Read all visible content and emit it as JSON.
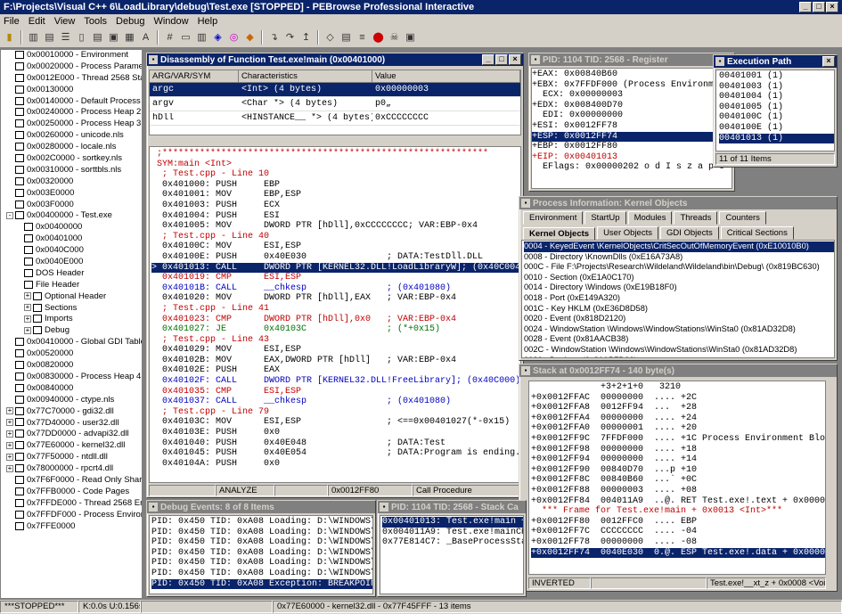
{
  "app": {
    "title": "F:\\Projects\\Visual C++ 6\\LoadLibrary\\debug\\Test.exe [STOPPED] - PEBrowse Professional Interactive",
    "menu": [
      "File",
      "Edit",
      "View",
      "Tools",
      "Debug",
      "Window",
      "Help"
    ]
  },
  "tree": [
    {
      "t": "0x00010000 - Environment",
      "d": 1
    },
    {
      "t": "0x00020000 - Process Paramet",
      "d": 1
    },
    {
      "t": "0x0012E000 - Thread 2568 Sta",
      "d": 1
    },
    {
      "t": "0x00130000",
      "d": 1
    },
    {
      "t": "0x00140000 - Default Process I",
      "d": 1
    },
    {
      "t": "0x00240000 - Process Heap 2",
      "d": 1
    },
    {
      "t": "0x00250000 - Process Heap 3",
      "d": 1
    },
    {
      "t": "0x00260000 - unicode.nls",
      "d": 1
    },
    {
      "t": "0x00280000 - locale.nls",
      "d": 1
    },
    {
      "t": "0x002C0000 - sortkey.nls",
      "d": 1
    },
    {
      "t": "0x00310000 - sorttbls.nls",
      "d": 1
    },
    {
      "t": "0x00320000",
      "d": 1
    },
    {
      "t": "0x003E0000",
      "d": 1
    },
    {
      "t": "0x003F0000",
      "d": 1
    },
    {
      "t": "0x00400000 - Test.exe",
      "d": 0,
      "ex": "-"
    },
    {
      "t": "0x00400000",
      "d": 2
    },
    {
      "t": "0x00401000",
      "d": 2
    },
    {
      "t": "0x0040C000",
      "d": 2
    },
    {
      "t": "0x0040E000",
      "d": 2
    },
    {
      "t": "DOS Header",
      "d": 2
    },
    {
      "t": "File Header",
      "d": 2
    },
    {
      "t": "Optional Header",
      "d": 2,
      "ex": "+"
    },
    {
      "t": "Sections",
      "d": 2,
      "ex": "+"
    },
    {
      "t": "Imports",
      "d": 2,
      "ex": "+"
    },
    {
      "t": "Debug",
      "d": 2,
      "ex": "+"
    },
    {
      "t": "0x00410000 - Global GDI Table",
      "d": 1
    },
    {
      "t": "0x00520000",
      "d": 1
    },
    {
      "t": "0x00820000",
      "d": 1
    },
    {
      "t": "0x00830000 - Process Heap 4",
      "d": 1
    },
    {
      "t": "0x00840000",
      "d": 1
    },
    {
      "t": "0x00940000 - ctype.nls",
      "d": 1
    },
    {
      "t": "0x77C70000 - gdi32.dll",
      "d": 0,
      "ex": "+"
    },
    {
      "t": "0x77D40000 - user32.dll",
      "d": 0,
      "ex": "+"
    },
    {
      "t": "0x77DD0000 - advapi32.dll",
      "d": 0,
      "ex": "+"
    },
    {
      "t": "0x77E60000 - kernel32.dll",
      "d": 0,
      "ex": "+"
    },
    {
      "t": "0x77F50000 - ntdll.dll",
      "d": 0,
      "ex": "+"
    },
    {
      "t": "0x78000000 - rpcrt4.dll",
      "d": 0,
      "ex": "+"
    },
    {
      "t": "0x7F6F0000 - Read Only Share",
      "d": 1
    },
    {
      "t": "0x7FFB0000 - Code Pages",
      "d": 1
    },
    {
      "t": "0x7FFDE000 - Thread 2568 En",
      "d": 1
    },
    {
      "t": "0x7FFDF000 - Process Environ",
      "d": 1
    },
    {
      "t": "0x7FFE0000",
      "d": 1
    }
  ],
  "disasm": {
    "title": "Disassembly of Function Test.exe!main (0x00401000)",
    "columns": [
      "ARG/VAR/SYM",
      "Characteristics",
      "Value"
    ],
    "vars": [
      {
        "name": "argc",
        "ch": "<Int> (4 bytes)",
        "val": "0x00000003",
        "sel": true
      },
      {
        "name": "argv",
        "ch": "<Char *> (4 bytes)",
        "val": "p0„"
      },
      {
        "name": "hDll",
        "ch": "<HINSTANCE__ *> (4 bytes)",
        "val": "0xCCCCCCCC"
      }
    ],
    "lines": [
      {
        "t": " ;*************************************************************",
        "c": "red"
      },
      {
        "t": " SYM:main <Int>",
        "c": "red"
      },
      {
        "t": "  ; Test.cpp - Line 10",
        "c": "red"
      },
      {
        "t": "  0x401000: PUSH     EBP"
      },
      {
        "t": "  0x401001: MOV      EBP,ESP"
      },
      {
        "t": "  0x401003: PUSH     ECX"
      },
      {
        "t": "  0x401004: PUSH     ESI"
      },
      {
        "t": "  0x401005: MOV      DWORD PTR [hDll],0xCCCCCCCC; VAR:EBP-0x4"
      },
      {
        "t": "  ; Test.cpp - Line 40",
        "c": "red"
      },
      {
        "t": "  0x40100C: MOV      ESI,ESP"
      },
      {
        "t": "  0x40100E: PUSH     0x40E030               ; DATA:TestDll.DLL"
      },
      {
        "t": "> 0x401013: CALL     DWORD PTR [KERNEL32.DLL!LoadLibraryW]; (0x40C004)",
        "c": "sel"
      },
      {
        "t": "  0x401019: CMP      ESI,ESP",
        "c": "red"
      },
      {
        "t": "  0x40101B: CALL     __chkesp               ; (0x401080)",
        "c": "blue"
      },
      {
        "t": "  0x401020: MOV      DWORD PTR [hDll],EAX   ; VAR:EBP-0x4"
      },
      {
        "t": "  ; Test.cpp - Line 41",
        "c": "red"
      },
      {
        "t": "  0x401023: CMP      DWORD PTR [hDll],0x0   ; VAR:EBP-0x4",
        "c": "red"
      },
      {
        "t": "  0x401027: JE       0x40103C               ; (*+0x15)",
        "c": "green"
      },
      {
        "t": "  ; Test.cpp - Line 43",
        "c": "red"
      },
      {
        "t": "  0x401029: MOV      ESI,ESP"
      },
      {
        "t": "  0x40102B: MOV      EAX,DWORD PTR [hDll]   ; VAR:EBP-0x4"
      },
      {
        "t": "  0x40102E: PUSH     EAX"
      },
      {
        "t": "  0x40102F: CALL     DWORD PTR [KERNEL32.DLL!FreeLibrary]; (0x40C000)",
        "c": "blue"
      },
      {
        "t": "  0x401035: CMP      ESI,ESP",
        "c": "red"
      },
      {
        "t": "  0x401037: CALL     __chkesp               ; (0x401080)",
        "c": "blue"
      },
      {
        "t": "  ; Test.cpp - Line 79",
        "c": "red"
      },
      {
        "t": "  0x40103C: MOV      ESI,ESP                ; <==0x00401027(*-0x15)"
      },
      {
        "t": "  0x40103E: PUSH     0x0"
      },
      {
        "t": "  0x401040: PUSH     0x40E048               ; DATA:Test"
      },
      {
        "t": "  0x401045: PUSH     0x40E054               ; DATA:Program is ending."
      },
      {
        "t": "  0x40104A: PUSH     0x0"
      }
    ],
    "status": [
      "",
      "ANALYZE",
      "",
      "0x0012FF80",
      "Call Procedure"
    ]
  },
  "registers": {
    "title": "PID: 1104 TID: 2568 - Register",
    "lines": [
      {
        "t": "+EAX: 0x00840B60"
      },
      {
        "t": "+EBX: 0x7FFDF000 (Process Environme"
      },
      {
        "t": "  ECX: 0x00000003"
      },
      {
        "t": "+EDX: 0x008400D70"
      },
      {
        "t": "  EDI: 0x00000000"
      },
      {
        "t": "+ESI: 0x0012FF78"
      },
      {
        "t": "+ESP: 0x0012FF74",
        "c": "sel"
      },
      {
        "t": "+EBP: 0x0012FF80"
      },
      {
        "t": "+EIP: 0x00401013",
        "c": "red"
      },
      {
        "t": "  EFlags: 0x00000202 o d I s z a p c"
      }
    ]
  },
  "execpath": {
    "title": "Execution Path",
    "lines": [
      {
        "t": "00401001 (1)"
      },
      {
        "t": "00401003 (1)"
      },
      {
        "t": "00401004 (1)"
      },
      {
        "t": "00401005 (1)"
      },
      {
        "t": "0040100C (1)"
      },
      {
        "t": "0040100E (1)"
      },
      {
        "t": "00401013 (1)",
        "c": "sel"
      }
    ],
    "status": "11 of 11 Items"
  },
  "procinfo": {
    "title": "Process Information: Kernel Objects",
    "tabs_row1": [
      "Environment",
      "StartUp",
      "Modules",
      "Threads",
      "Counters"
    ],
    "tabs_row2": [
      "Kernel Objects",
      "User Objects",
      "GDI Objects",
      "Critical Sections"
    ],
    "lines": [
      {
        "t": "0004 - KeyedEvent \\KernelObjects\\CritSecOutOfMemoryEvent (0xE10010B0)",
        "c": "sel"
      },
      {
        "t": "0008 - Directory \\KnownDlls (0xE16A73A8)"
      },
      {
        "t": "000C - File F:\\Projects\\Research\\Wildeland\\Wildeland\\bin\\Debug\\ (0x819BC630)"
      },
      {
        "t": "0010 - Section (0xE1A0C170)"
      },
      {
        "t": "0014 - Directory \\Windows (0xE19B18F0)"
      },
      {
        "t": "0018 - Port (0xE149A320)"
      },
      {
        "t": "001C - Key HKLM (0xE36D8D58)"
      },
      {
        "t": "0020 - Event (0x818D2120)"
      },
      {
        "t": "0024 - WindowStation \\Windows\\WindowStations\\WinSta0 (0x81AD32D8)"
      },
      {
        "t": "0028 - Event (0x81AACB38)"
      },
      {
        "t": "002C - WindowStation \\Windows\\WindowStations\\WinSta0 (0x81AD32D8)"
      },
      {
        "t": "0030 - Desktop (0x81AB7D20)"
      }
    ]
  },
  "stack": {
    "title": "Stack at 0x0012FF74 - 140 byte(s)",
    "header": "             +3+2+1+0   3210",
    "lines": [
      {
        "t": "+0x0012FFAC  00000000  .... +2C"
      },
      {
        "t": "+0x0012FFA8  0012FF94  ...  +28"
      },
      {
        "t": "+0x0012FFA4  00000000  .... +24"
      },
      {
        "t": "+0x0012FFA0  00000001  .... +20"
      },
      {
        "t": "+0x0012FF9C  7FFDF000  .... +1C Process Environment Block"
      },
      {
        "t": "+0x0012FF98  00000000  .... +18"
      },
      {
        "t": "+0x0012FF94  00000000  .... +14"
      },
      {
        "t": "+0x0012FF90  00840D70  ...p +10"
      },
      {
        "t": "+0x0012FF8C  00840B60  ...` +0C"
      },
      {
        "t": "+0x0012FF88  00000003  .... +08"
      },
      {
        "t": "+0x0012FF84  004011A9  ..@. RET Test.exe!.text + 0x00000:"
      },
      {
        "t": "  *** Frame for Test.exe!main + 0x0013 <Int>***",
        "c": "red"
      },
      {
        "t": "+0x0012FF80  0012FFC0  .... EBP"
      },
      {
        "t": "+0x0012FF7C  CCCCCCCC  .... -04"
      },
      {
        "t": "+0x0012FF78  00000000  .... -08"
      },
      {
        "t": "+0x0012FF74  0040E030  0.@. ESP Test.exe!.data + 0x000000",
        "c": "sel"
      }
    ],
    "status": [
      "INVERTED",
      "",
      "Test.exe!__xt_z + 0x0008 <Voic"
    ]
  },
  "debugevents": {
    "title": "Debug Events: 8 of 8 Items",
    "lines": [
      {
        "t": "PID: 0x450 TID: 0xA08 Loading: D:\\WINDOWS\\sy"
      },
      {
        "t": "PID: 0x450 TID: 0xA08 Loading: D:\\WINDOWS\\sy"
      },
      {
        "t": "PID: 0x450 TID: 0xA08 Loading: D:\\WINDOWS\\sy"
      },
      {
        "t": "PID: 0x450 TID: 0xA08 Loading: D:\\WINDOWS\\sy"
      },
      {
        "t": "PID: 0x450 TID: 0xA08 Loading: D:\\WINDOWS\\sy"
      },
      {
        "t": "PID: 0x450 TID: 0xA08 Loading: D:\\WINDOWS\\sy"
      },
      {
        "t": "PID: 0x450 TID: 0xA08 Exception: BREAKPOINT",
        "c": "sel"
      }
    ]
  },
  "callstack": {
    "title": "PID: 1104 TID: 2568 - Stack Ca",
    "lines": [
      {
        "t": "0x00401013: Test.exe!main +",
        "c": "sel"
      },
      {
        "t": "0x004011A9: Test.exe!mainCRTS"
      },
      {
        "t": "0x77E814C7: _BaseProcessStart"
      }
    ]
  },
  "statusbar": [
    "***STOPPED***",
    "K:0.0s U:0.156s",
    "",
    "0x77E60000 - kernel32.dll - 0x77F45FFF - 13 items"
  ]
}
